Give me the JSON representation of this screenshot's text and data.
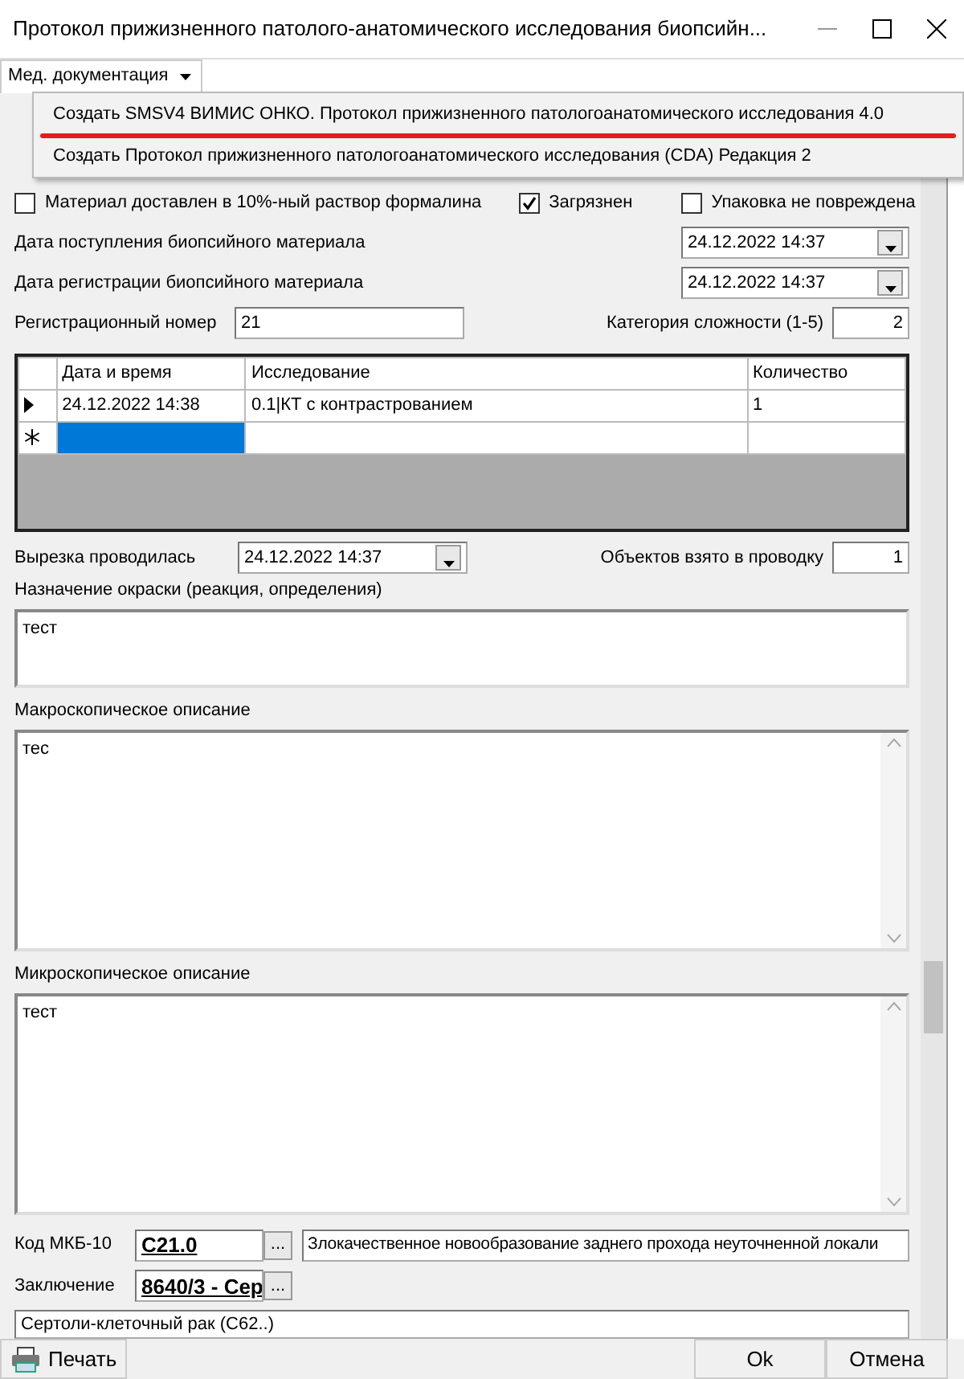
{
  "window": {
    "title": "Протокол прижизненного патолого-анатомического исследования биопсийн..."
  },
  "menu": {
    "label": "Мед. документация",
    "items": [
      {
        "label": "Создать SMSV4 ВИМИС ОНКО. Протокол прижизненного патологоанатомического исследования 4.0",
        "underlined": true
      },
      {
        "label": "Создать Протокол прижизненного патологоанатомического исследования (CDA) Редакция 2",
        "underlined": false
      }
    ]
  },
  "checkboxes": [
    {
      "label": "Материал доставлен в 10%-ный раствор формалина",
      "checked": false
    },
    {
      "label": "Загрязнен",
      "checked": true
    },
    {
      "label": "Упаковка не повреждена",
      "checked": false
    }
  ],
  "date_fields": [
    {
      "label": "Дата поступления биопсийного материала",
      "value": "24.12.2022 14:37"
    },
    {
      "label": "Дата регистрации биопсийного материала",
      "value": "24.12.2022 14:37"
    }
  ],
  "registration": {
    "label": "Регистрационный номер",
    "value": "21"
  },
  "complexity": {
    "label": "Категория сложности (1-5)",
    "value": "2"
  },
  "grid": {
    "columns": [
      "Дата и время",
      "Исследование",
      "Количество"
    ],
    "rows": [
      {
        "kind": "current",
        "cells": [
          "24.12.2022 14:38",
          "0.1|КТ с контрастрованием",
          "1"
        ],
        "selected": false
      },
      {
        "kind": "new",
        "selected": true
      }
    ]
  },
  "cut": {
    "label": "Вырезка проводилась",
    "value": "24.12.2022 14:37"
  },
  "objects": {
    "label": "Объектов взято в проводку",
    "value": "1"
  },
  "text_areas": [
    {
      "label": "Назначение окраски (реакция, определения)",
      "value": "тест",
      "scrollbar": false
    },
    {
      "label": "Макроскопическое описание",
      "value": "тес",
      "scrollbar": true
    },
    {
      "label": "Микроскопическое описание",
      "value": "тест",
      "scrollbar": true
    }
  ],
  "mkb": {
    "label": "Код МКБ-10",
    "code": "C21.0",
    "description": "Злокачественное новообразование заднего прохода неуточненной локали"
  },
  "conclusion": {
    "label": "Заключение",
    "code": "8640/3 - Сер",
    "text": "Сертоли-клеточный рак (С62..)"
  },
  "browse_buttons": [
    "...",
    "..."
  ],
  "buttons": {
    "print": "Печать",
    "ok": "Ok",
    "cancel": "Отмена"
  }
}
